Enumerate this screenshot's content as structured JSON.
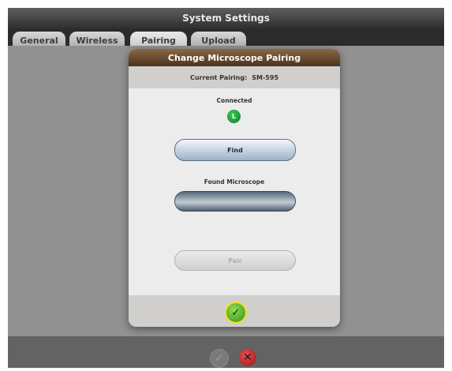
{
  "window": {
    "title": "System Settings"
  },
  "tabs": [
    {
      "label": "General"
    },
    {
      "label": "Wireless"
    },
    {
      "label": "Pairing"
    },
    {
      "label": "Upload"
    }
  ],
  "active_tab": "Pairing",
  "dialog": {
    "title": "Change Microscope Pairing",
    "current_pairing_label": "Current Pairing:",
    "current_pairing_value": "SM-595",
    "status_label": "Connected",
    "status_indicator_text": "L",
    "find_button_label": "Find",
    "found_label": "Found Microscope",
    "found_value": "",
    "pair_button_label": "Pair",
    "pair_button_enabled": false,
    "confirm_icon": "check-icon"
  },
  "bottom_bar": {
    "ok_icon": "check-icon",
    "ok_enabled": false,
    "cancel_icon": "x-icon"
  },
  "colors": {
    "title_bar": "#3f3f3f",
    "dialog_header": "#6b4d30",
    "status_green": "#1e9e3a",
    "find_button": "#c2d0de",
    "confirm_highlight": "#f3e126",
    "cancel_red": "#c62828"
  }
}
